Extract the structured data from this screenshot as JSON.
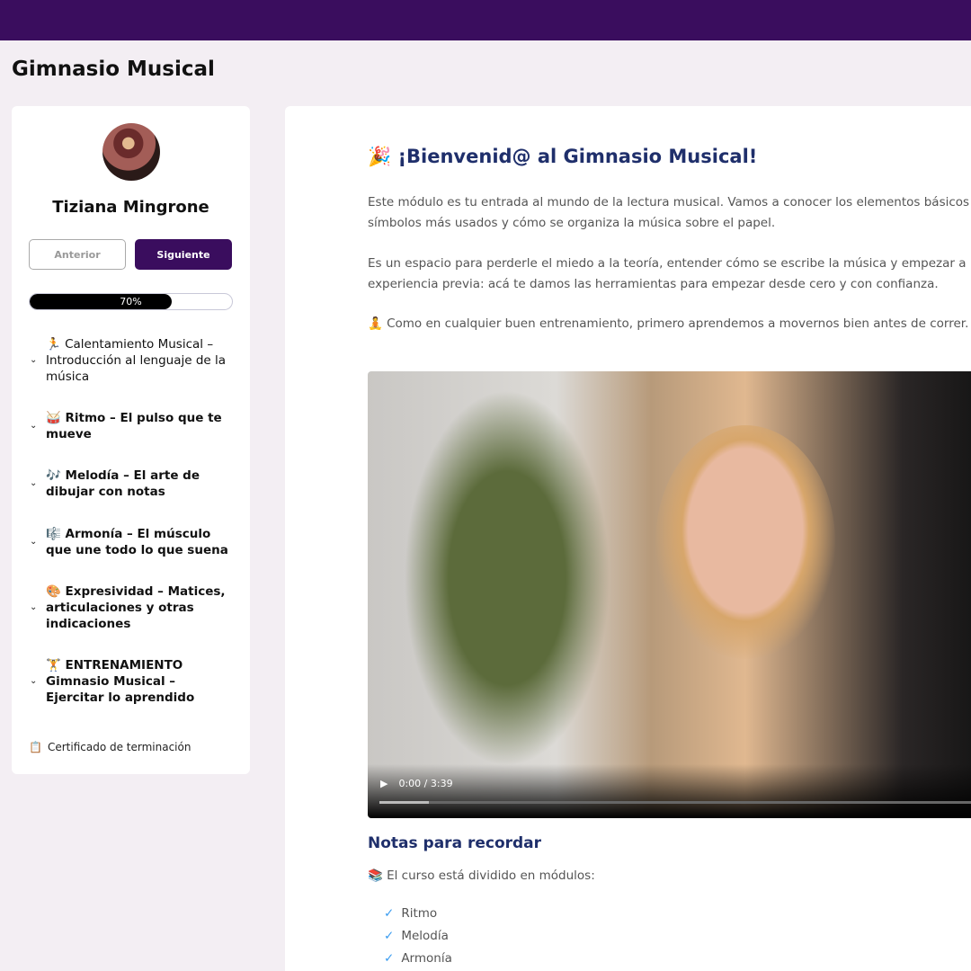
{
  "app": {
    "title": "Gimnasio Musical"
  },
  "sidebar": {
    "user_name": "Tiziana Mingrone",
    "prev_label": "Anterior",
    "next_label": "Siguiente",
    "progress": {
      "value": 70,
      "label": "70%"
    },
    "modules": [
      {
        "emoji": "🏃",
        "label": "Calentamiento Musical – Introducción al lenguaje de la música"
      },
      {
        "emoji": "🥁",
        "label": "Ritmo – El pulso que te mueve"
      },
      {
        "emoji": "🎶",
        "label": "Melodía – El arte de dibujar con notas"
      },
      {
        "emoji": "🎼",
        "label": "Armonía – El músculo que une todo lo que suena"
      },
      {
        "emoji": "🎨",
        "label": "Expresividad – Matices, articulaciones y otras indicaciones"
      },
      {
        "emoji": "🏋",
        "label": "ENTRENAMIENTO Gimnasio Musical – Ejercitar lo aprendido"
      }
    ],
    "certificate": "Certificado de terminación"
  },
  "main": {
    "heading": "🎉 ¡Bienvenid@ al Gimnasio Musical!",
    "para1_line1": "Este módulo es tu entrada al mundo de la lectura musical. Vamos a conocer los elementos básicos de",
    "para1_line2": "símbolos más usados y cómo se organiza la música sobre el papel.",
    "para2_line1": "Es un espacio para perderle el miedo a la teoría, entender cómo se escribe la música y empezar a leer",
    "para2_line2": "experiencia previa: acá te damos las herramientas para empezar desde cero y con confianza.",
    "para3": "🧘 Como en cualquier buen entrenamiento, primero aprendemos a movernos bien antes de correr.",
    "video": {
      "time": "0:00 / 3:39",
      "progress": 0.08
    },
    "notes_heading": "Notas para recordar",
    "notes_intro": "📚 El curso está dividido en módulos:",
    "notes_list": [
      "Ritmo",
      "Melodía",
      "Armonía"
    ]
  }
}
